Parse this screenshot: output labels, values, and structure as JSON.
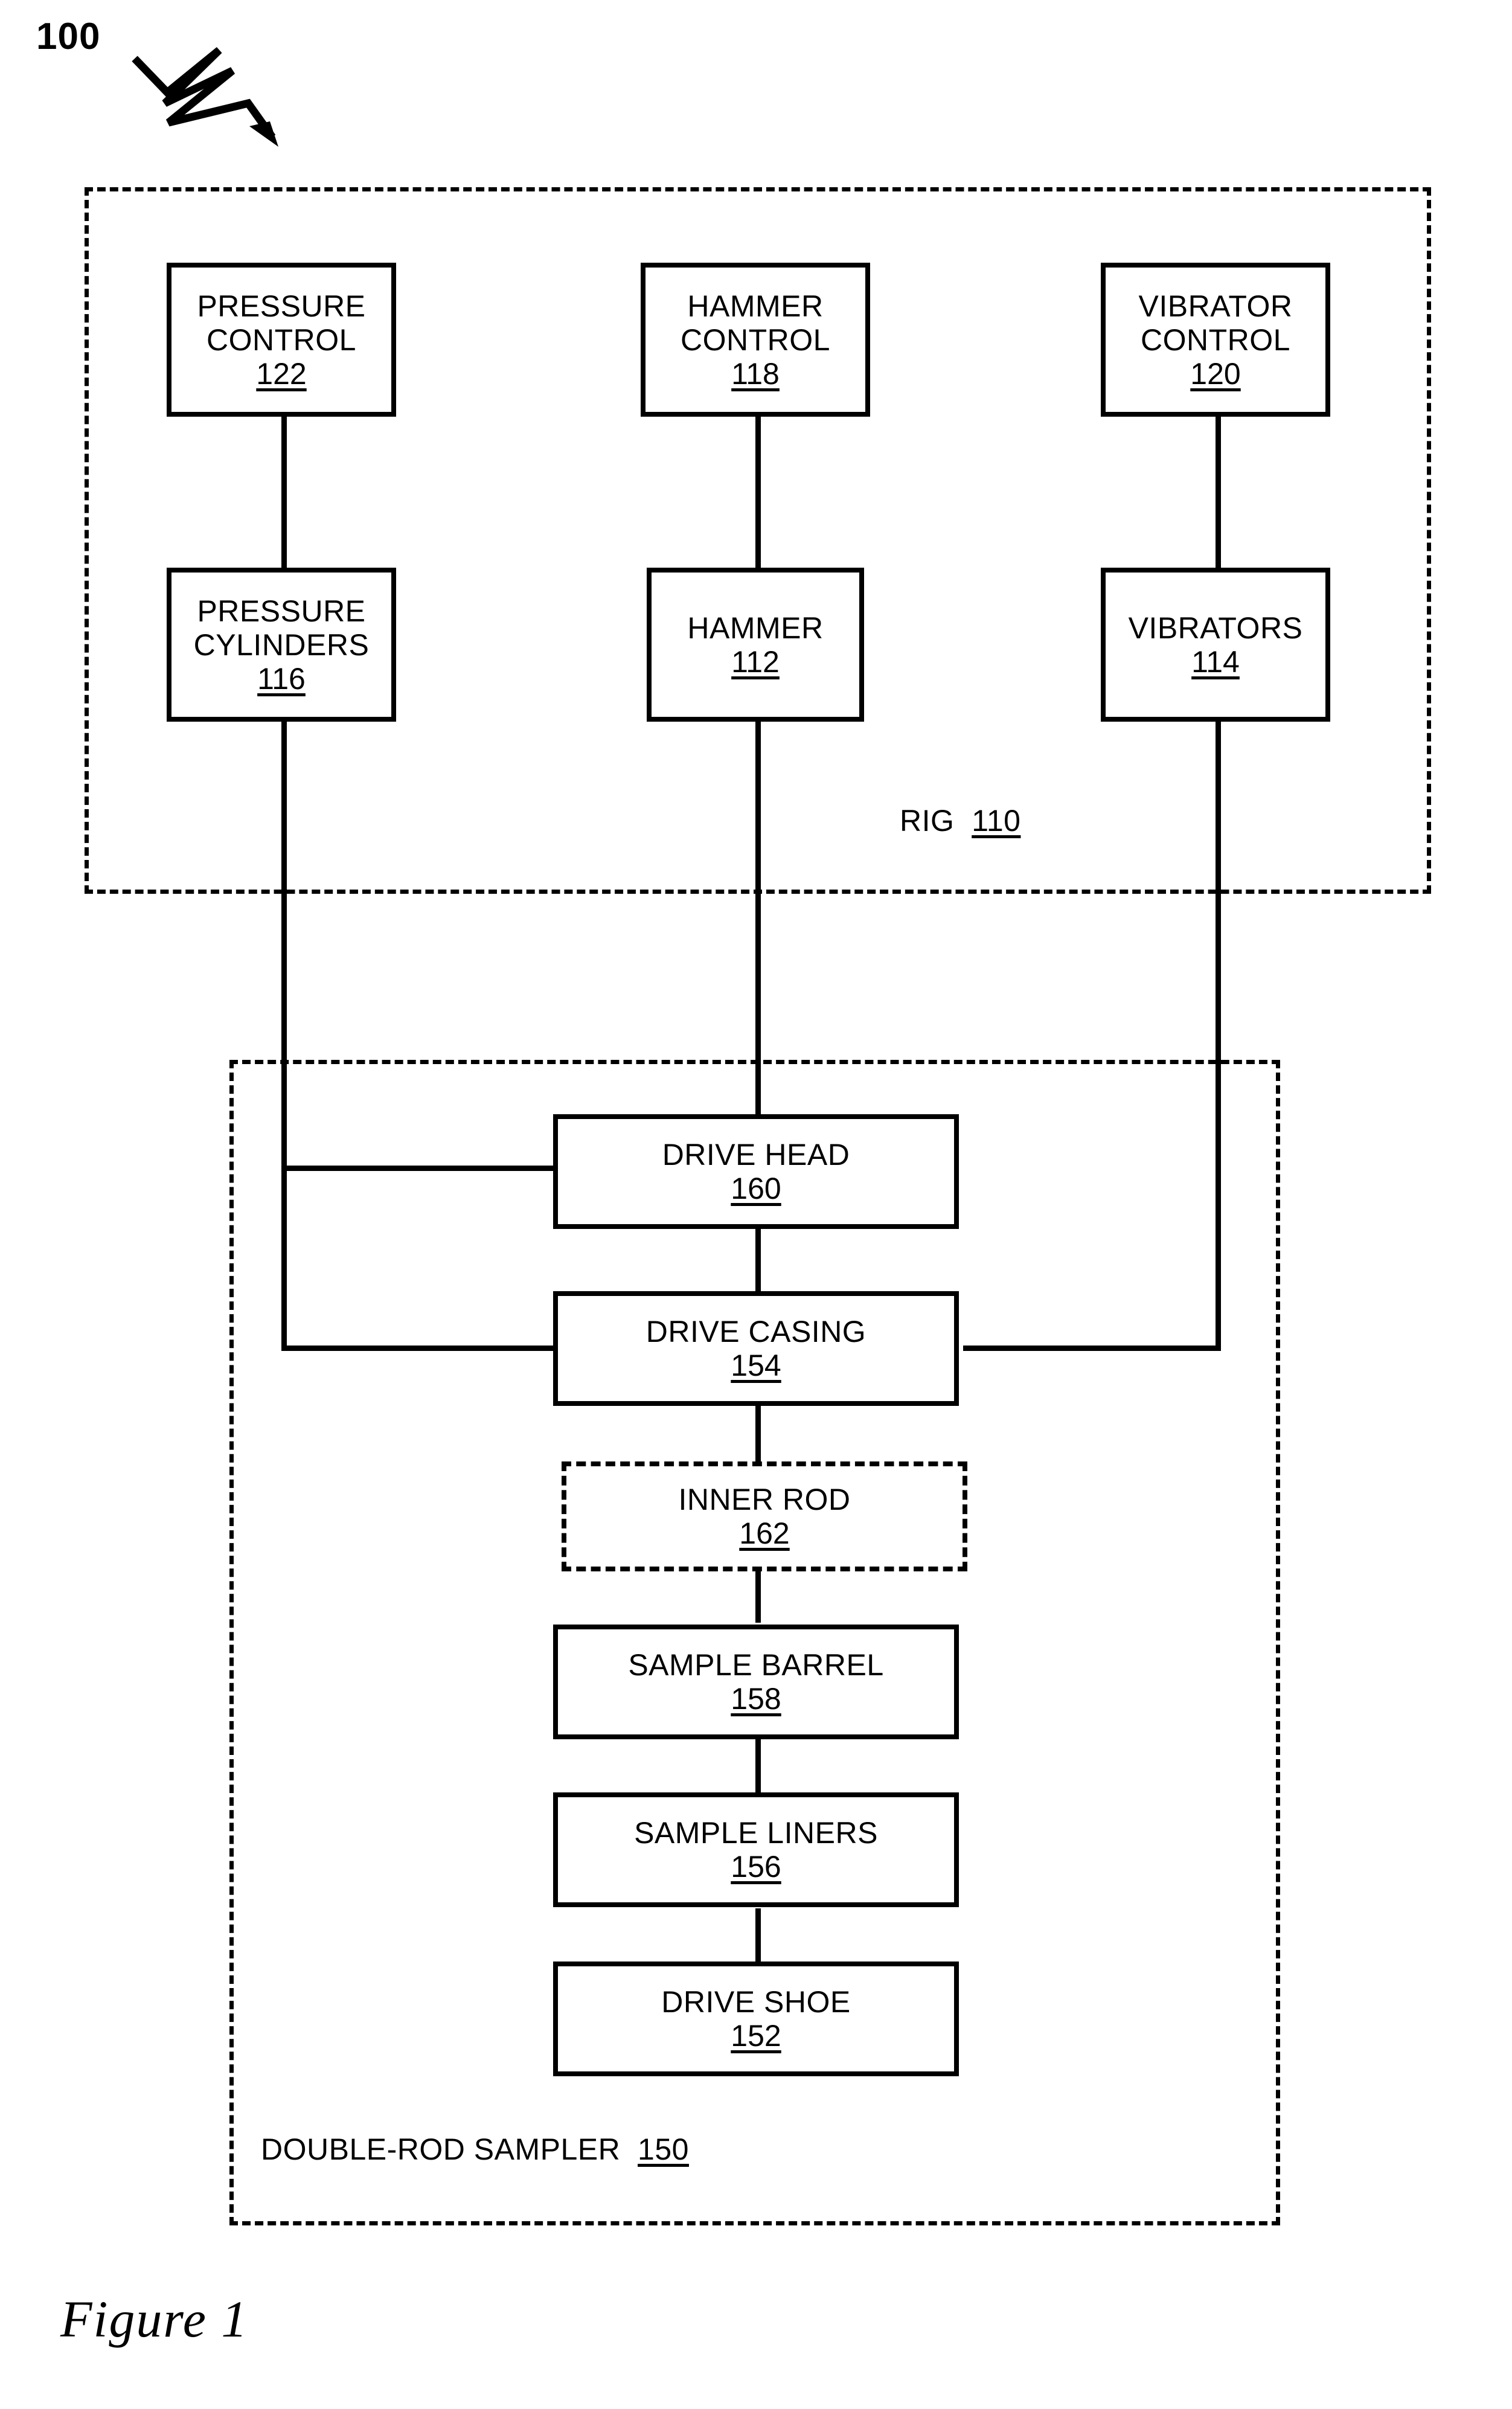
{
  "figure": {
    "caption": "Figure 1",
    "system_ref": "100"
  },
  "rig": {
    "label_text": "RIG",
    "label_ref": "110",
    "boxes": [
      {
        "id": "pressure-control",
        "label": "PRESSURE\nCONTROL",
        "line1": "PRESSURE",
        "line2": "CONTROL",
        "ref": "122"
      },
      {
        "id": "hammer-control",
        "label": "HAMMER\nCONTROL",
        "line1": "HAMMER",
        "line2": "CONTROL",
        "ref": "118"
      },
      {
        "id": "vibrator-control",
        "label": "VIBRATOR\nCONTROL",
        "line1": "VIBRATOR",
        "line2": "CONTROL",
        "ref": "120"
      },
      {
        "id": "pressure-cylinders",
        "label": "PRESSURE\nCYLINDERS",
        "line1": "PRESSURE",
        "line2": "CYLINDERS",
        "ref": "116"
      },
      {
        "id": "hammer",
        "label": "HAMMER",
        "line1": "HAMMER",
        "line2": "",
        "ref": "112"
      },
      {
        "id": "vibrators",
        "label": "VIBRATORS",
        "line1": "VIBRATORS",
        "line2": "",
        "ref": "114"
      }
    ]
  },
  "sampler": {
    "label_text": "DOUBLE-ROD SAMPLER",
    "label_ref": "150",
    "boxes": [
      {
        "id": "drive-head",
        "label": "DRIVE HEAD",
        "ref": "160",
        "style": "solid"
      },
      {
        "id": "drive-casing",
        "label": "DRIVE CASING",
        "ref": "154",
        "style": "solid"
      },
      {
        "id": "inner-rod",
        "label": "INNER ROD",
        "ref": "162",
        "style": "dashed"
      },
      {
        "id": "sample-barrel",
        "label": "SAMPLE BARREL",
        "ref": "158",
        "style": "solid"
      },
      {
        "id": "sample-liners",
        "label": "SAMPLE LINERS",
        "ref": "156",
        "style": "solid"
      },
      {
        "id": "drive-shoe",
        "label": "DRIVE SHOE",
        "ref": "152",
        "style": "solid"
      }
    ]
  },
  "colors": {
    "ink": "#000000",
    "paper": "#ffffff"
  }
}
